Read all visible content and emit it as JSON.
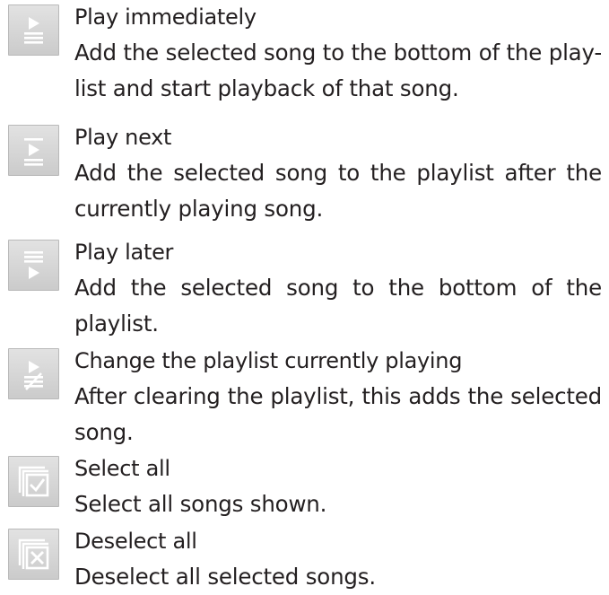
{
  "items": [
    {
      "icon": "play-immediately-icon",
      "title": "Play immediately",
      "description": "Add the selected song to the bottom of the play-list and start playback of that song."
    },
    {
      "icon": "play-next-icon",
      "title": "Play next",
      "description": "Add the selected song to the playlist after the currently playing song."
    },
    {
      "icon": "play-later-icon",
      "title": "Play later",
      "description": "Add the selected song to the bottom of the playlist."
    },
    {
      "icon": "change-playlist-icon",
      "title": "Change the playlist currently playing",
      "description": "After clearing the playlist, this adds the selected song."
    },
    {
      "icon": "select-all-icon",
      "title": "Select all",
      "description": "Select all songs shown."
    },
    {
      "icon": "deselect-all-icon",
      "title": "Deselect all",
      "description": "Deselect all selected songs."
    }
  ]
}
